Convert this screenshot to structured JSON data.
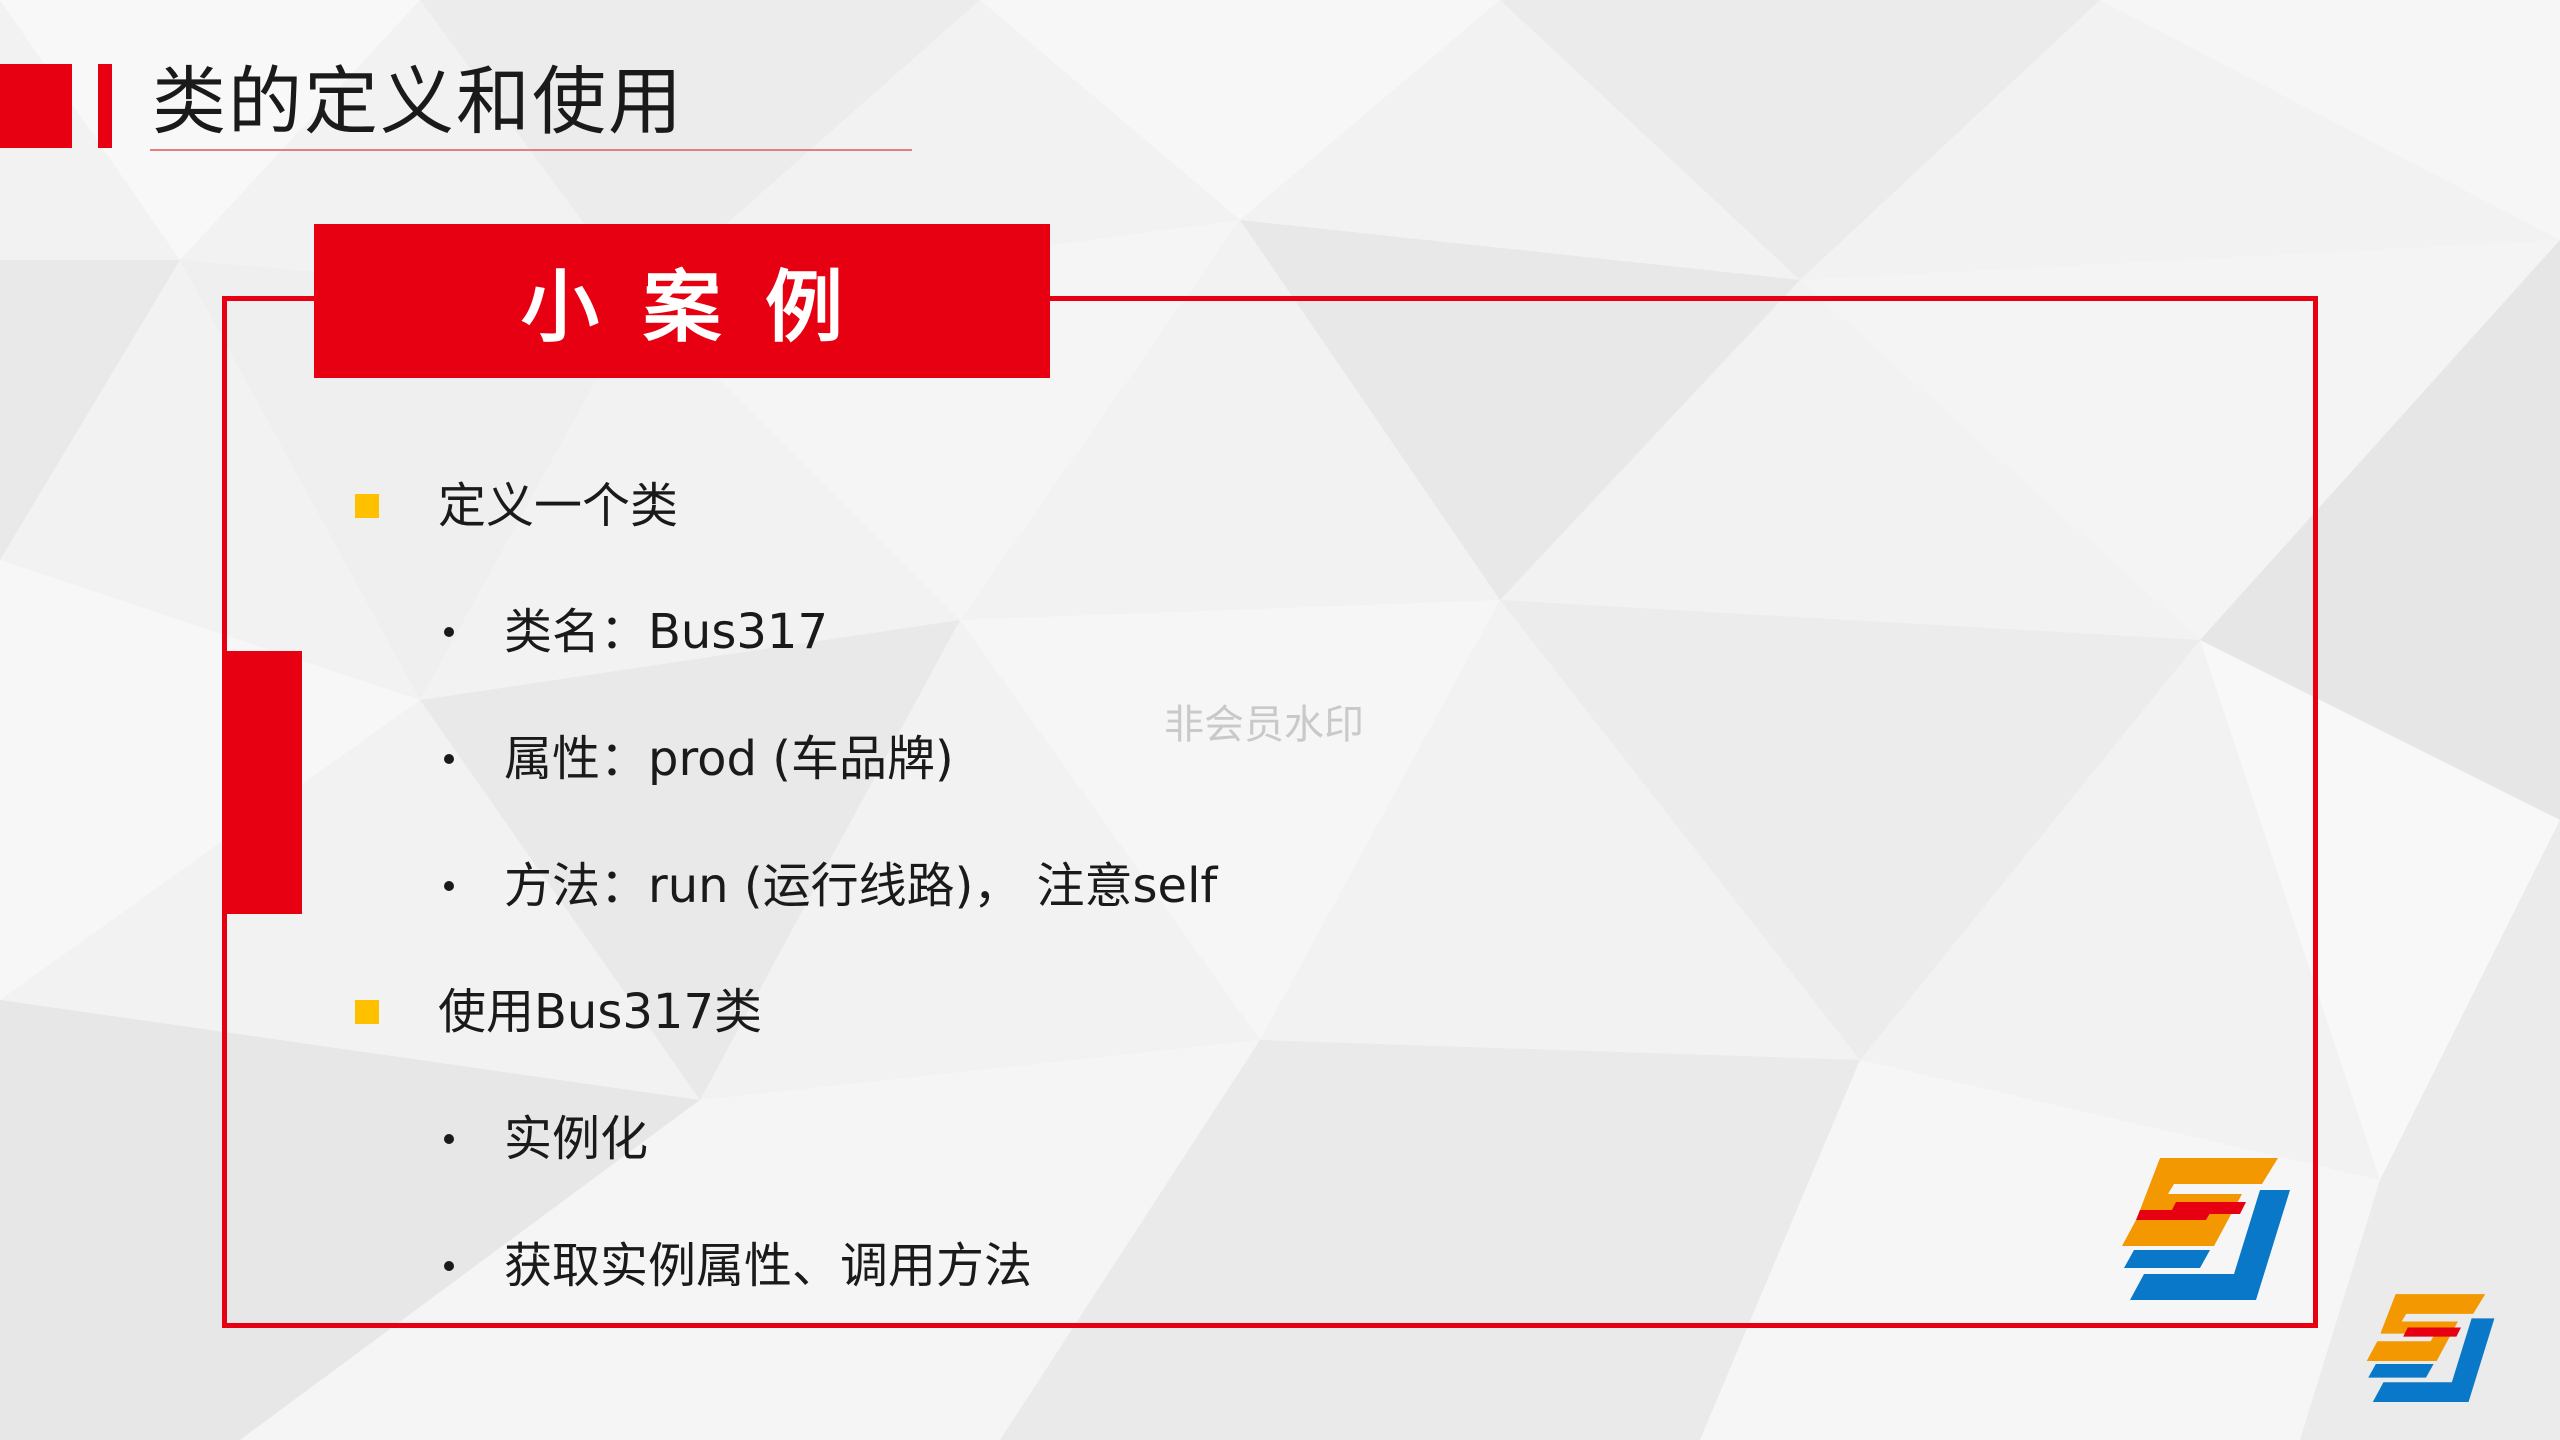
{
  "header": {
    "title": "类的定义和使用"
  },
  "banner": {
    "label": "小案例"
  },
  "content": {
    "items": [
      {
        "level": 1,
        "text": "定义一个类"
      },
      {
        "level": 2,
        "text": "类名：Bus317"
      },
      {
        "level": 2,
        "text": "属性：prod (车品牌)"
      },
      {
        "level": 2,
        "text": "方法：run (运行线路)， 注意self"
      },
      {
        "level": 1,
        "text": "使用Bus317类"
      },
      {
        "level": 2,
        "text": "实例化"
      },
      {
        "level": 2,
        "text": "获取实例属性、调用方法"
      }
    ]
  },
  "watermark": {
    "text": "非会员水印"
  },
  "logo": {
    "icon": "sj-logo-icon"
  },
  "colors": {
    "accent_red": "#e60012",
    "bullet_yellow": "#ffc000",
    "logo_orange": "#f39800",
    "logo_red": "#e60012",
    "logo_blue": "#0a78c8"
  }
}
